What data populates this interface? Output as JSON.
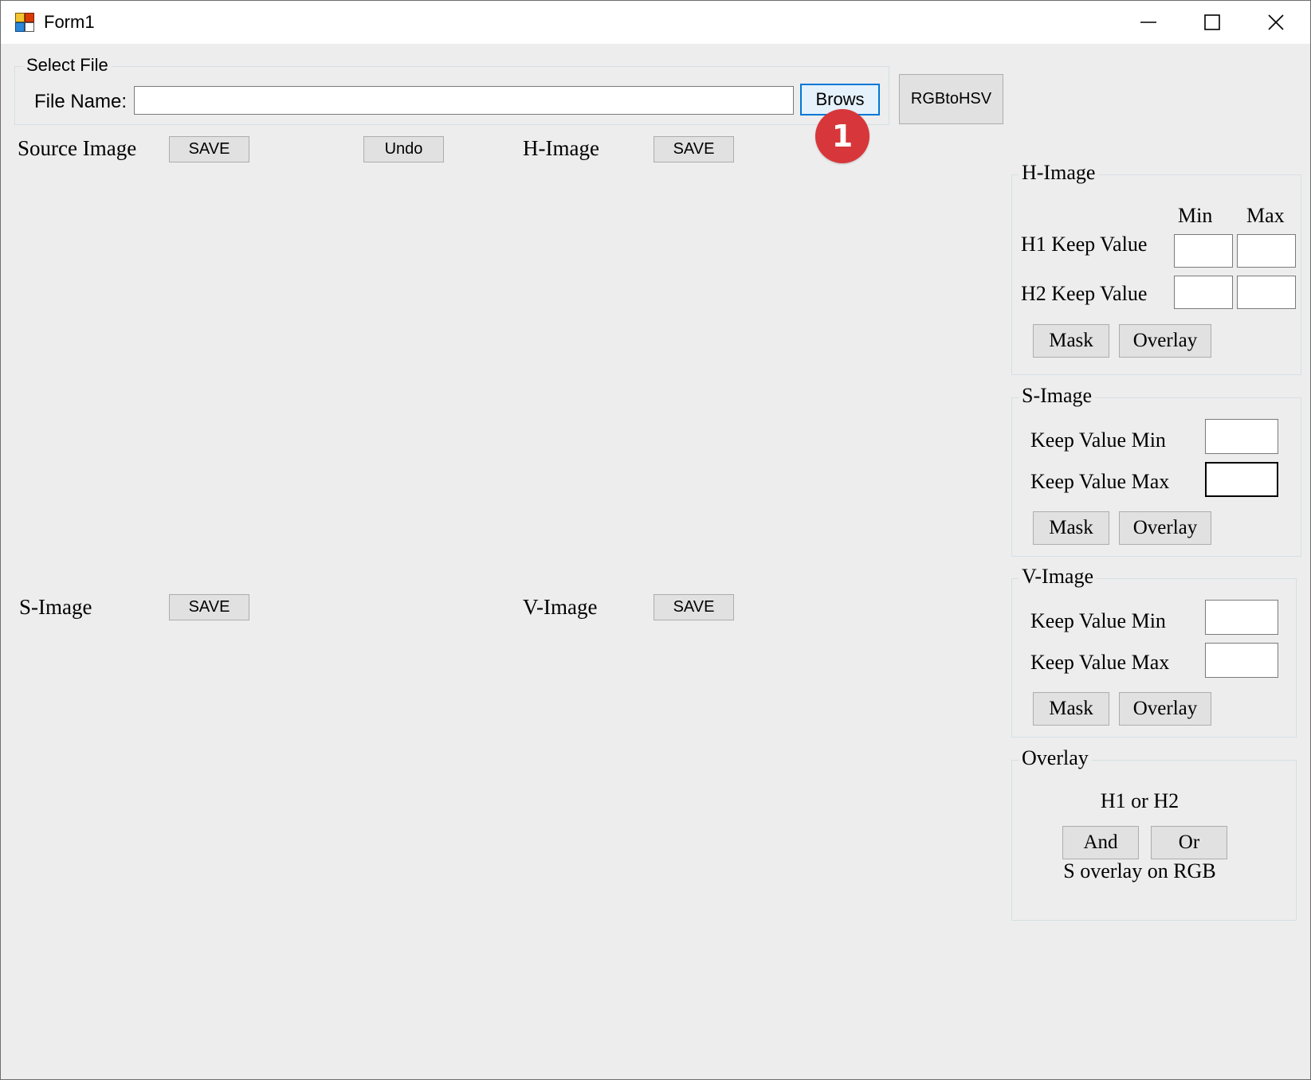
{
  "window": {
    "title": "Form1",
    "icon": "winforms-app-icon",
    "controls": {
      "minimize": "minimize-icon",
      "maximize": "maximize-icon",
      "close": "close-icon"
    }
  },
  "select_file": {
    "group_title": "Select File",
    "file_name_label": "File Name:",
    "file_name_value": "",
    "browse_label": "Brows"
  },
  "rgb_to_hsv_label": "RGBtoHSV",
  "images": {
    "source": {
      "label": "Source Image",
      "save_label": "SAVE",
      "undo_label": "Undo"
    },
    "h": {
      "label": "H-Image",
      "save_label": "SAVE"
    },
    "s": {
      "label": "S-Image",
      "save_label": "SAVE"
    },
    "v": {
      "label": "V-Image",
      "save_label": "SAVE"
    }
  },
  "h_group": {
    "title": "H-Image",
    "min_header": "Min",
    "max_header": "Max",
    "h1_label": "H1 Keep Value",
    "h2_label": "H2 Keep Value",
    "h1_min": "",
    "h1_max": "",
    "h2_min": "",
    "h2_max": "",
    "mask_label": "Mask",
    "overlay_label": "Overlay"
  },
  "s_group": {
    "title": "S-Image",
    "min_label": "Keep Value Min",
    "max_label": "Keep Value Max",
    "min_value": "",
    "max_value": "",
    "mask_label": "Mask",
    "overlay_label": "Overlay"
  },
  "v_group": {
    "title": "V-Image",
    "min_label": "Keep Value Min",
    "max_label": "Keep Value Max",
    "min_value": "",
    "max_value": "",
    "mask_label": "Mask",
    "overlay_label": "Overlay"
  },
  "overlay_group": {
    "title": "Overlay",
    "h_caption": "H1 or H2",
    "and_label": "And",
    "or_label": "Or",
    "s_caption": "S overlay on RGB"
  },
  "annotation": {
    "step": "1"
  },
  "colors": {
    "form_background": "#ededed",
    "button_face": "#e1e1e1",
    "focus_border": "#0078d7",
    "badge": "#d7373a"
  }
}
